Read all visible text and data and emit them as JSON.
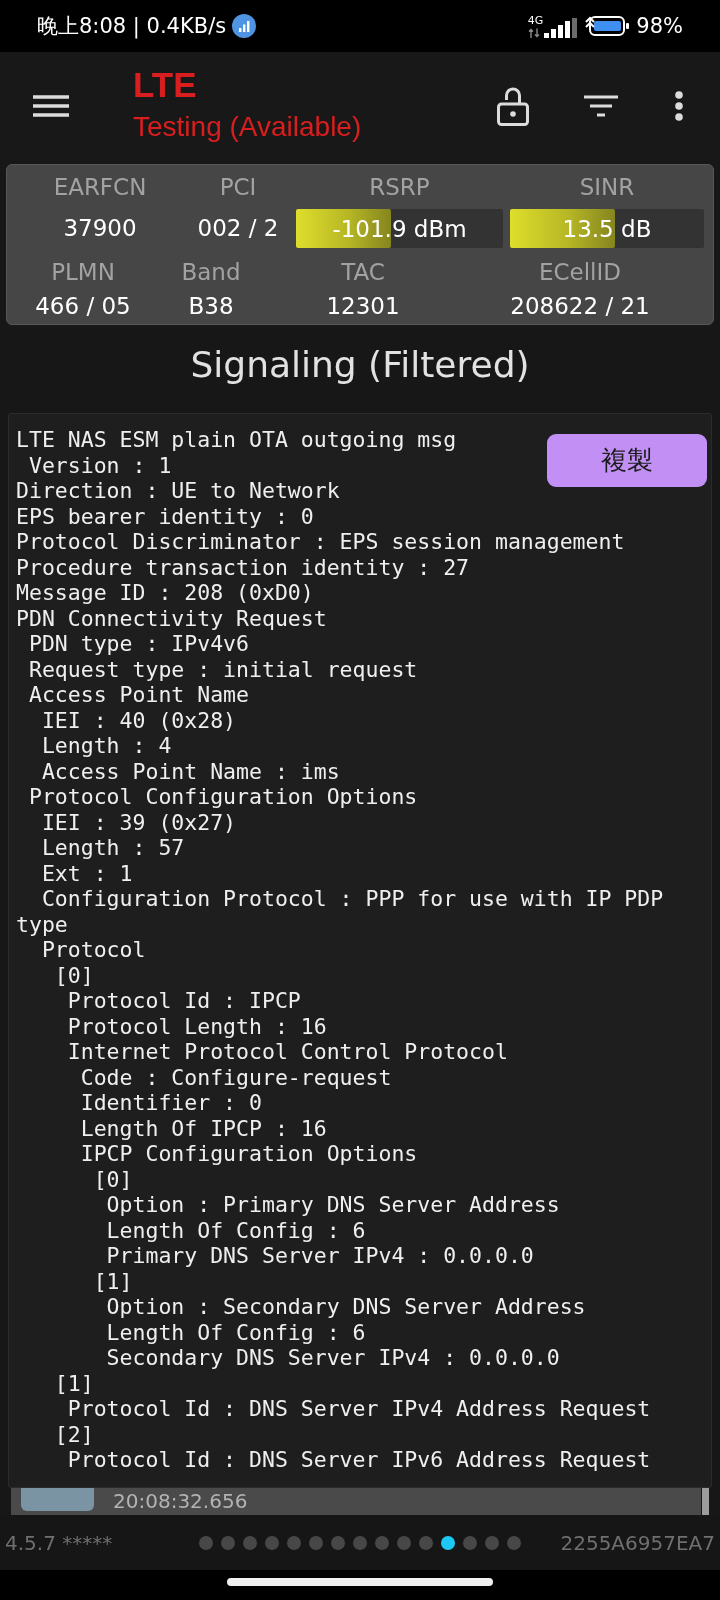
{
  "status_bar": {
    "time_and_speed": "晚上8:08 | 0.4KB/s",
    "network_type": "4G",
    "battery": "98%"
  },
  "toolbar": {
    "title": "LTE",
    "subtitle": "Testing (Available)"
  },
  "cell_info": {
    "row_1": [
      {
        "kind": "value",
        "label": "EARFCN",
        "value": "37900"
      },
      {
        "kind": "value",
        "label": "PCI",
        "value": "002 / 2"
      },
      {
        "kind": "meter",
        "label": "RSRP",
        "value": "-101.9 dBm",
        "level": 0.46
      },
      {
        "kind": "meter",
        "label": "SINR",
        "value": "13.5 dB",
        "level": 0.54
      }
    ],
    "row_2": [
      {
        "label": "PLMN",
        "value": "466 / 05"
      },
      {
        "label": "Band",
        "value": "B38"
      },
      {
        "label": "TAC",
        "value": "12301"
      },
      {
        "label": "ECellID",
        "value": "208622 / 21"
      }
    ]
  },
  "section_title": "Signaling (Filtered)",
  "message_dialog": {
    "copy_button": "複製",
    "lines": [
      "LTE NAS ESM plain OTA outgoing msg",
      " Version : 1",
      "Direction : UE to Network",
      "EPS bearer identity : 0",
      "Protocol Discriminator : EPS session management",
      "Procedure transaction identity : 27",
      "Message ID : 208 (0xD0)",
      "PDN Connectivity Request",
      " PDN type : IPv4v6",
      " Request type : initial request",
      " Access Point Name",
      "  IEI : 40 (0x28)",
      "  Length : 4",
      "  Access Point Name : ims",
      " Protocol Configuration Options",
      "  IEI : 39 (0x27)",
      "  Length : 57",
      "  Ext : 1",
      "  Configuration Protocol : PPP for use with IP PDP type",
      "  Protocol",
      "   [0]",
      "    Protocol Id : IPCP",
      "    Protocol Length : 16",
      "    Internet Protocol Control Protocol",
      "     Code : Configure-request",
      "     Identifier : 0",
      "     Length Of IPCP : 16",
      "     IPCP Configuration Options",
      "      [0]",
      "       Option : Primary DNS Server Address",
      "       Length Of Config : 6",
      "       Primary DNS Server IPv4 : 0.0.0.0",
      "      [1]",
      "       Option : Secondary DNS Server Address",
      "       Length Of Config : 6",
      "       Secondary DNS Server IPv4 : 0.0.0.0",
      "   [1]",
      "    Protocol Id : DNS Server IPv4 Address Request",
      "   [2]",
      "    Protocol Id : DNS Server IPv6 Address Request"
    ]
  },
  "signal_list": {
    "rows": [
      {
        "time": "20:08:32.656",
        "selected": true,
        "color": "#7b94a3"
      }
    ]
  },
  "footer": {
    "version": "4.5.7 *****",
    "pages": [
      {
        "selected": false
      },
      {
        "selected": false
      },
      {
        "selected": false
      },
      {
        "selected": false
      },
      {
        "selected": false
      },
      {
        "selected": false
      },
      {
        "selected": false
      },
      {
        "selected": false
      },
      {
        "selected": false
      },
      {
        "selected": false
      },
      {
        "selected": false
      },
      {
        "selected": true
      },
      {
        "selected": false
      },
      {
        "selected": false
      },
      {
        "selected": false
      }
    ],
    "device_id": "2255A6957EA7"
  }
}
